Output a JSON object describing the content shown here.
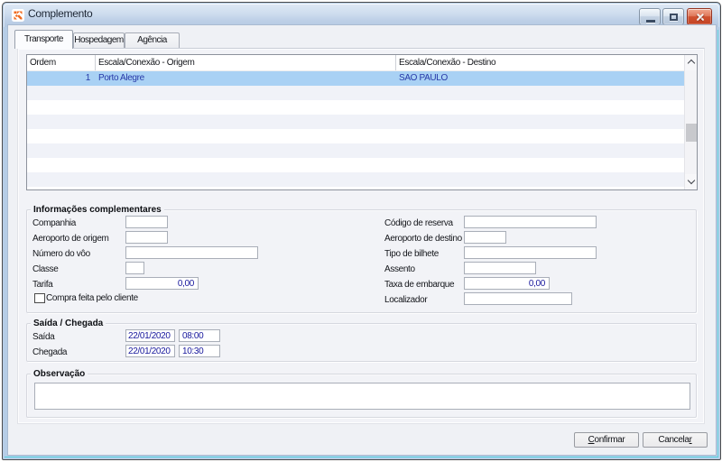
{
  "window": {
    "title": "Complemento",
    "controls": {
      "minimize": "minimize",
      "maximize": "maximize",
      "close": "close"
    },
    "icon": "app-pinwheel"
  },
  "colors": {
    "titlebar_top": "#dfe9f5",
    "titlebar_bottom": "#b4c9e2",
    "frame": "#b6cde6",
    "client_bg": "#eff1f5",
    "page_bg": "#f2f3f7",
    "selected_row": "#a9d1f4",
    "row_alt": "#f0f2f8",
    "value_text": "#17179c",
    "grid_text": "#2739a8",
    "close_red": "#c34425"
  },
  "tabs": [
    {
      "label": "Transporte",
      "active": true
    },
    {
      "label": "Hospedagem",
      "active": false
    },
    {
      "label": "Agência",
      "active": false
    }
  ],
  "grid": {
    "columns": [
      "Ordem",
      "Escala/Conexão - Origem",
      "Escala/Conexão - Destino"
    ],
    "selected_row": {
      "ordem": "1",
      "origem": "Porto Alegre",
      "destino": "SAO PAULO"
    },
    "scrollbar": {
      "orientation": "vertical",
      "up": "up-chevron",
      "down": "down-chevron"
    }
  },
  "info": {
    "title": "Informações complementares",
    "left": [
      {
        "label": "Companhia",
        "value": ""
      },
      {
        "label": "Aeroporto de origem",
        "value": ""
      },
      {
        "label": "Número do vôo",
        "value": ""
      },
      {
        "label": "Classe",
        "value": ""
      },
      {
        "label": "Tarifa",
        "value": "0,00"
      }
    ],
    "checkbox": {
      "label": "Compra feita pelo cliente",
      "checked": false
    },
    "right": [
      {
        "label": "Código de reserva",
        "value": ""
      },
      {
        "label": "Aeroporto de destino",
        "value": ""
      },
      {
        "label": "Tipo de bilhete",
        "value": ""
      },
      {
        "label": "Assento",
        "value": ""
      },
      {
        "label": "Taxa de embarque",
        "value": "0,00"
      },
      {
        "label": "Localizador",
        "value": ""
      }
    ]
  },
  "schedule": {
    "title": "Saída / Chegada",
    "rows": [
      {
        "label": "Saída",
        "date": "22/01/2020",
        "time": "08:00"
      },
      {
        "label": "Chegada",
        "date": "22/01/2020",
        "time": "10:30"
      }
    ]
  },
  "notes": {
    "title": "Observação",
    "value": ""
  },
  "footer": {
    "confirm_mnemonic": "C",
    "confirm_rest": "onfirmar",
    "cancel_rest": "Cancela",
    "cancel_mnemonic": "r"
  }
}
